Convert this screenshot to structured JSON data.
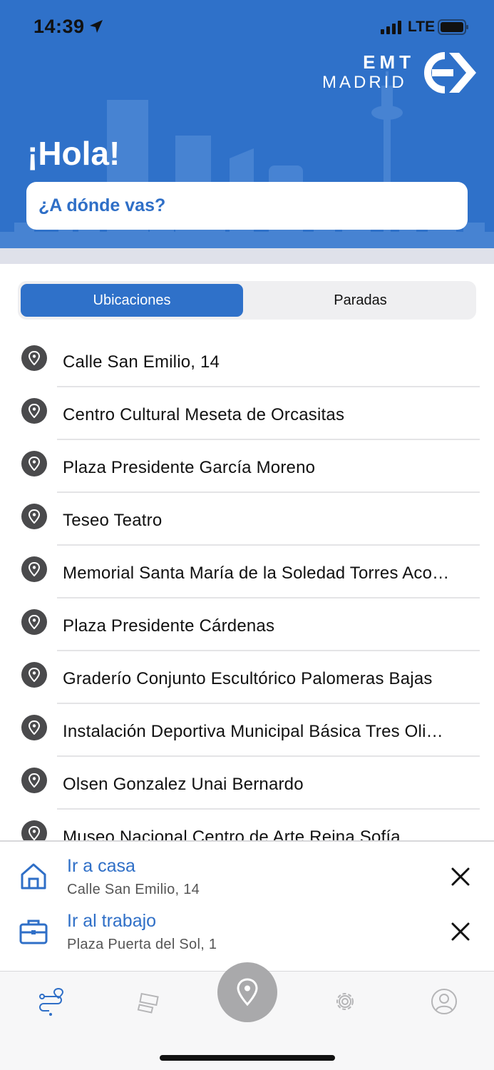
{
  "status_bar": {
    "time": "14:39",
    "network": "LTE"
  },
  "brand": {
    "line1": "EMT",
    "line2": "MADRID"
  },
  "header": {
    "greeting": "¡Hola!",
    "search_placeholder": "¿A dónde vas?"
  },
  "segmented": {
    "tabs": [
      {
        "label": "Ubicaciones",
        "selected": true
      },
      {
        "label": "Paradas",
        "selected": false
      }
    ]
  },
  "locations": [
    {
      "label": "Calle San Emilio, 14",
      "icon": "location-pin-icon"
    },
    {
      "label": "Centro Cultural Meseta de Orcasitas",
      "icon": "location-pin-icon"
    },
    {
      "label": "Plaza Presidente García Moreno",
      "icon": "location-pin-icon"
    },
    {
      "label": "Teseo Teatro",
      "icon": "location-pin-icon"
    },
    {
      "label": "Memorial Santa María de la Soledad Torres Aco…",
      "icon": "location-pin-icon"
    },
    {
      "label": "Plaza Presidente Cárdenas",
      "icon": "location-pin-icon"
    },
    {
      "label": "Graderío Conjunto Escultórico Palomeras Bajas",
      "icon": "location-pin-icon"
    },
    {
      "label": "Instalación Deportiva Municipal Básica Tres Oli…",
      "icon": "location-pin-icon"
    },
    {
      "label": "Olsen Gonzalez Unai Bernardo",
      "icon": "location-pin-icon"
    },
    {
      "label": "Museo Nacional Centro de Arte Reina Sofía",
      "icon": "location-pin-icon"
    }
  ],
  "shortcuts": {
    "home": {
      "title": "Ir a casa",
      "address": "Calle San Emilio, 14",
      "icon": "home-icon"
    },
    "work": {
      "title": "Ir al trabajo",
      "address": "Plaza Puerta del Sol, 1",
      "icon": "briefcase-icon"
    }
  },
  "tab_bar": {
    "items": [
      {
        "icon": "route-icon",
        "active": true
      },
      {
        "icon": "ticket-icon",
        "active": false
      },
      {
        "icon": "location-pin-icon",
        "active": false
      },
      {
        "icon": "gear-icon",
        "active": false
      },
      {
        "icon": "user-icon",
        "active": false
      }
    ]
  },
  "colors": {
    "brand_blue": "#2f71c9",
    "link_blue": "#2f6fc7",
    "pin_gray": "#4a4a4c",
    "center_button": "#a9a9ab"
  }
}
